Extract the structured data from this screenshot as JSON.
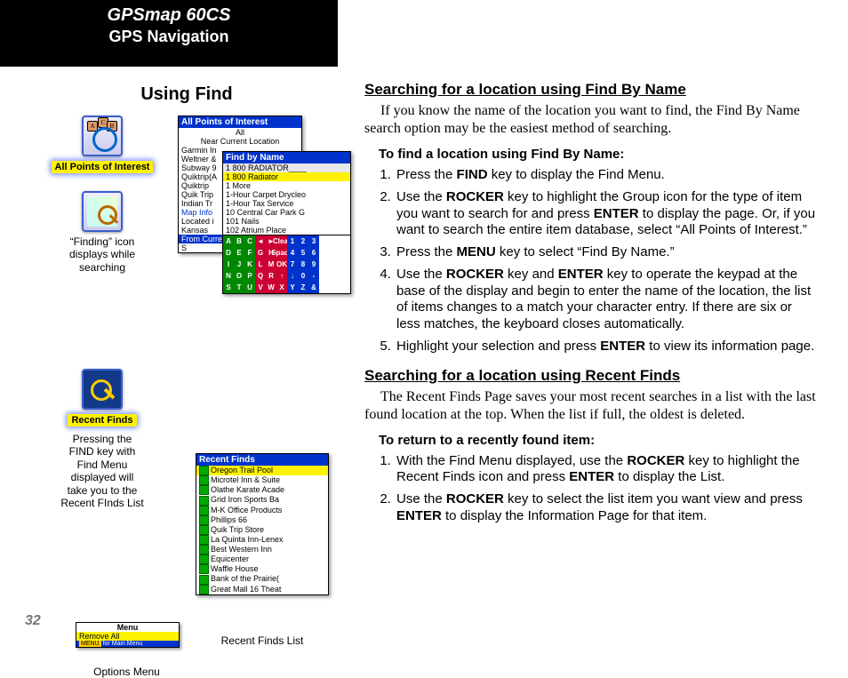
{
  "header": {
    "line1": "GPSmap 60CS",
    "line2": "GPS Navigation"
  },
  "left": {
    "title": "Using Find",
    "poi_label": "All Points of Interest",
    "finding_caption": "“Finding” icon\ndisplays while\nsearching",
    "recent_label": "Recent Finds",
    "recent_caption": "Pressing the\nFIND key with\nFind Menu\ndisplayed will\ntake you to the\nRecent FInds List",
    "options_caption": "Options Menu",
    "recent_list_caption": "Recent Finds List"
  },
  "poi_screen": {
    "title": "All Points of Interest",
    "sub1": "All",
    "sub2": "Near Current Location",
    "left_list": [
      "Garmin In",
      "Weltner &",
      "Subway 9",
      "Quiktrip(A",
      "Quiktrip",
      "Quik Trip",
      "Indian Tr",
      "Map Info",
      "Located i",
      "Kansas",
      "From Curre",
      "S"
    ],
    "find_title": "Find by Name",
    "find_input": "1 800 RADIATOR____",
    "right_list": [
      "1 800 Radiator",
      "1 More",
      "1-Hour Carpet Drycleo",
      "1-Hour Tax Service",
      "10 Central Car Park G",
      "101 Nails",
      "102 Atrium Place"
    ]
  },
  "keypad": {
    "rows": [
      [
        "A",
        "B",
        "C",
        "◄",
        "►",
        "Clear",
        "1",
        "2",
        "3"
      ],
      [
        "D",
        "E",
        "F",
        "G",
        "H",
        "Space",
        "4",
        "5",
        "6"
      ],
      [
        "I",
        "J",
        "K",
        "L",
        "M",
        "OK",
        "7",
        "8",
        "9"
      ],
      [
        "N",
        "O",
        "P",
        "Q",
        "R",
        "↑",
        "↓",
        "0",
        "-",
        "+"
      ],
      [
        "S",
        "T",
        "U",
        "V",
        "W",
        "X",
        "Y",
        "Z",
        "&",
        "'"
      ]
    ]
  },
  "recent_finds": {
    "title": "Recent Finds",
    "items": [
      "Oregon Trail Pool",
      "Microtel Inn & Suite",
      "Olathe Karate Acade",
      "Grid Iron Sports Ba",
      "M-K Office Products",
      "Phillips 66",
      "Quik Trip Store",
      "La Quinta Inn-Lenex",
      "Best Western Inn",
      "Equicenter",
      "Waffle House",
      "Bank of the Prairie(",
      "Great Mall 16 Theat"
    ]
  },
  "options_menu": {
    "title": "Menu",
    "row": "Remove All",
    "footer": "MENU for Main Menu"
  },
  "right": {
    "h1": "Searching for a location using Find By Name",
    "p1": "If you know the name of the location you want to find, the Find By Name search option may be the easiest method of searching.",
    "sub1": "To find a location using Find By Name:",
    "s1": "Press the <b>FIND</b> key to display the Find Menu.",
    "s2": "Use the <b>ROCKER</b> key to highlight the Group icon for the type of item you want to search for and press <b>ENTER</b> to display the page. Or, if you want to search the entire item database, select “All Points of Interest.”",
    "s3": "Press the <b>MENU</b> key to select “Find By Name.”",
    "s4": "Use the <b>ROCKER</b> key and <b>ENTER</b> key to operate the keypad at the base of the display and begin to enter the name of the location, the list of items changes to a match your character entry. If there are six or less matches, the keyboard closes automatically.",
    "s5": "Highlight your selection and press <b>ENTER</b> to view its information page.",
    "h2": "Searching for a location using Recent Finds",
    "p2": "The Recent Finds Page saves your most recent searches in a list with the last found location at the top. When the list if full, the oldest is deleted.",
    "sub2": "To return to a recently found item:",
    "r1": "With the Find Menu displayed, use the <b>ROCKER</b> key to highlight the Recent Finds icon and press <b>ENTER</b> to display the List.",
    "r2": "Use the <b>ROCKER</b> key to select the list item you want view and press <b>ENTER</b> to display the Information Page for that item."
  },
  "page_number": "32"
}
